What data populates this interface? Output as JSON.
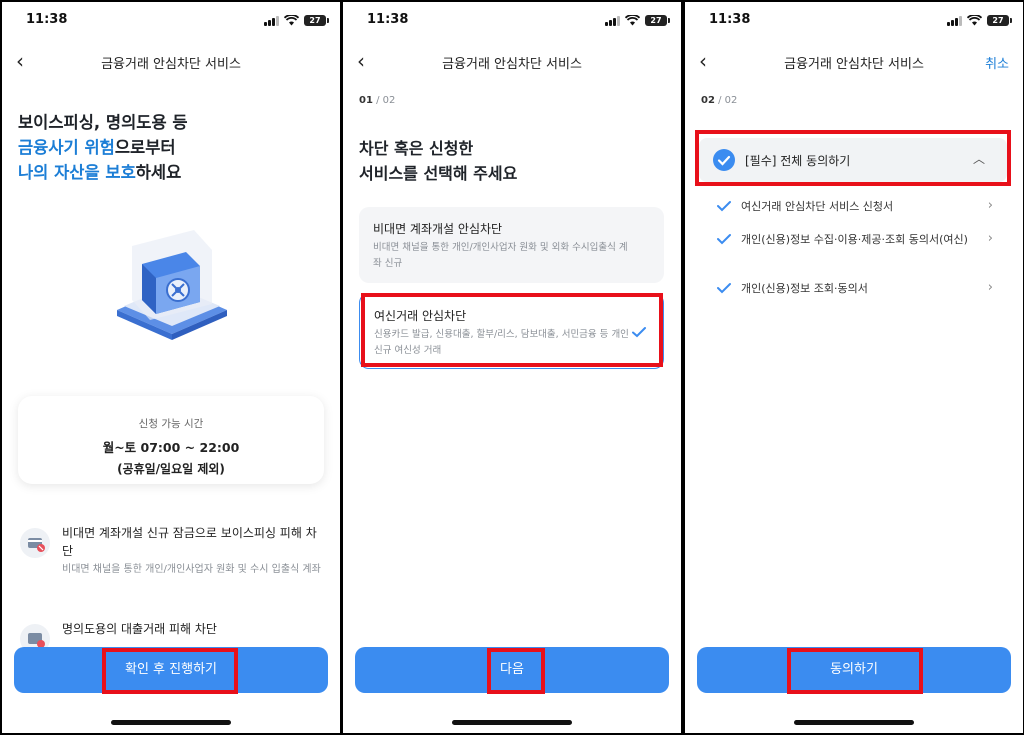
{
  "status": {
    "time": "11:38",
    "battery": "27"
  },
  "colors": {
    "accent": "#3b8cf0",
    "highlight": "#e8101a",
    "text_blue": "#1c7ed6"
  },
  "screen1": {
    "nav_title": "금융거래 안심차단 서비스",
    "hero_line1": "보이스피싱, 명의도용 등",
    "hero_line2_blue": "금융사기 위험",
    "hero_line2_rest": "으로부터",
    "hero_line3_blue": "나의 자산을 보호",
    "hero_line3_rest": "하세요",
    "hours_label": "신청 가능 시간",
    "hours_value": "월~토 07:00 ~ 22:00",
    "hours_note": "(공휴일/일요일 제외)",
    "features": [
      {
        "icon": "card-block-icon",
        "title": "비대면 계좌개설 신규 잠금으로 보이스피싱 피해 차단",
        "desc": "비대면 채널을 통한 개인/개인사업자 원화 및 수시 입출식 계좌"
      },
      {
        "icon": "loan-block-icon",
        "title": "명의도용의 대출거래 피해 차단",
        "desc": ""
      }
    ],
    "cta_label": "확인 후 진행하기"
  },
  "screen2": {
    "nav_title": "금융거래 안심차단 서비스",
    "step_current": "01",
    "step_total": "/ 02",
    "question_line1": "차단 혹은 신청한",
    "question_line2": "서비스를 선택해 주세요",
    "options": [
      {
        "title": "비대면 계좌개설 안심차단",
        "desc": "비대면 채널을 통한 개인/개인사업자 원화 및 외화 수시입출식 계좌 신규",
        "selected": false
      },
      {
        "title": "여신거래 안심차단",
        "desc": "신용카드 발급, 신용대출, 할부/리스, 담보대출, 서민금융 등 개인 신규 여신성 거래",
        "selected": true
      }
    ],
    "cta_label": "다음"
  },
  "screen3": {
    "nav_title": "금융거래 안심차단 서비스",
    "cancel_label": "취소",
    "step_current": "02",
    "step_total": "/ 02",
    "agree_all_label": "[필수] 전체 동의하기",
    "terms": [
      "여신거래 안심차단 서비스 신청서",
      "개인(신용)정보 수집·이용·제공·조회 동의서(여신)",
      "개인(신용)정보 조회·동의서"
    ],
    "cta_label": "동의하기"
  }
}
